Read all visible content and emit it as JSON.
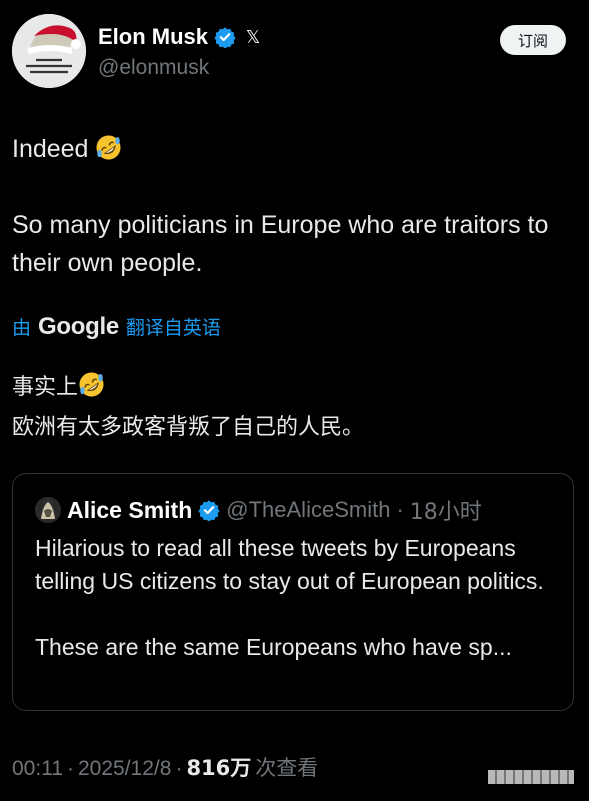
{
  "author": {
    "name": "Elon Musk",
    "handle": "@elonmusk",
    "verified_icon": "verified-badge-icon",
    "platform_icon": "x-logo-icon",
    "platform_glyph": "𝕏",
    "subscribe_label": "订阅",
    "avatar_icon": "santa-hat-avatar"
  },
  "tweet": {
    "line1": "Indeed",
    "line1_emoji": "rolling-on-floor-laughing-emoji",
    "line2": "So many politicians in Europe who are traitors to their own people."
  },
  "translation": {
    "prefix": "由",
    "provider": "Google",
    "suffix": "翻译自英语",
    "line1": "事实上",
    "line2": "欧洲有太多政客背叛了自己的人民。"
  },
  "quote": {
    "name": "Alice Smith",
    "handle": "@TheAliceSmith",
    "separator": "·",
    "time": "18小时",
    "para1": "Hilarious to read all these tweets by Europeans telling US citizens to stay out of European politics.",
    "para2": "These are the same Europeans who have sp..."
  },
  "meta": {
    "time": "00:11",
    "sep1": "·",
    "date": "2025/12/8",
    "sep2": "·",
    "views": "816万",
    "views_label": "次查看"
  },
  "colors": {
    "background": "#000000",
    "text": "#e7e9ea",
    "secondary": "#71767b",
    "link": "#1d9bf0",
    "verified": "#1d9bf0"
  }
}
